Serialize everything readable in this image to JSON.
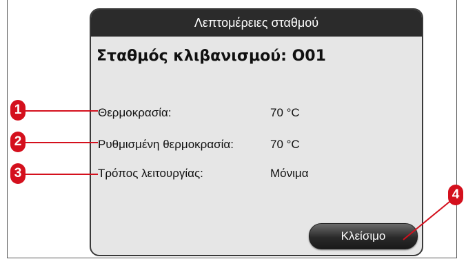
{
  "dialog": {
    "title": "Λεπτομέρειες σταθμού",
    "heading": "Σταθμός κλιβανισμού: O01",
    "rows": [
      {
        "label": "Θερμοκρασία:",
        "value": "70 °C"
      },
      {
        "label": "Ρυθμισμένη θερμοκρασία:",
        "value": "70 °C"
      },
      {
        "label": "Τρόπος λειτουργίας:",
        "value": "Μόνιμα"
      }
    ],
    "close_label": "Κλείσιμο"
  },
  "callouts": [
    "1",
    "2",
    "3",
    "4"
  ],
  "colors": {
    "callout": "#d4101d",
    "title_bar": "#2b2b2b",
    "dialog_bg": "#e6e6e6"
  }
}
